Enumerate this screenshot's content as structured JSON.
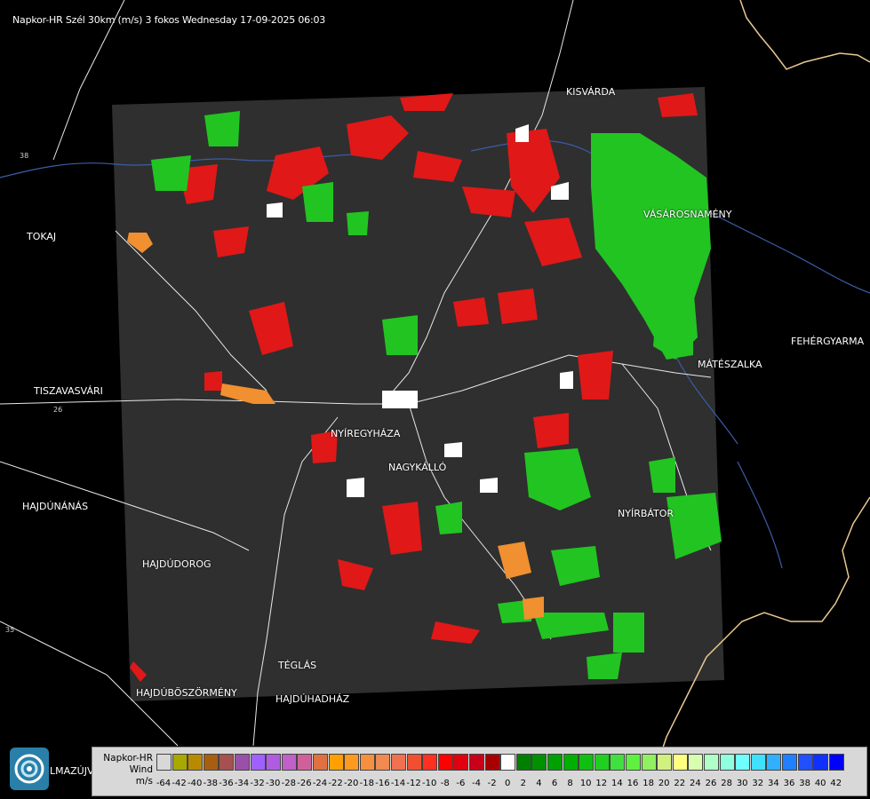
{
  "title": "Napkor-HR Szél 30km (m/s) 3 fokos Wednesday 17-09-2025 06:03",
  "towns": [
    {
      "id": "kisvarda",
      "name": "KISVÁRDA"
    },
    {
      "id": "tokaj",
      "name": "TOKAJ"
    },
    {
      "id": "vasarosnameny",
      "name": "VÁSÁROSNAMÉNY"
    },
    {
      "id": "fehergyarmat",
      "name": "FEHÉRGYARMA"
    },
    {
      "id": "mateszalka",
      "name": "MÁTÉSZALKA"
    },
    {
      "id": "tiszavasvari",
      "name": "TISZAVASVÁRI"
    },
    {
      "id": "nyiregyhaza",
      "name": "NYÍREGYHÁZA"
    },
    {
      "id": "nagykallo",
      "name": "NAGYKÁLLÓ"
    },
    {
      "id": "hajdunanas",
      "name": "HAJDÚNÁNÁS"
    },
    {
      "id": "nyirbator",
      "name": "NYÍRBÁTOR"
    },
    {
      "id": "hajdudorog",
      "name": "HAJDÚDOROG"
    },
    {
      "id": "teglas",
      "name": "TÉGLÁS"
    },
    {
      "id": "hajduboszormeny",
      "name": "HAJDÚBÖSZÖRMÉNY"
    },
    {
      "id": "hajduhadhaz",
      "name": "HAJDÚHADHÁZ"
    },
    {
      "id": "balmazujvaros",
      "name": "LMAZÚJVÁR"
    }
  ],
  "road_numbers": [
    "38",
    "26",
    "35"
  ],
  "legend": {
    "name_line1": "Napkor-HR",
    "name_line2": "Wind",
    "unit": "m/s",
    "ticks": [
      "-64",
      "-42",
      "-40",
      "-38",
      "-36",
      "-34",
      "-32",
      "-30",
      "-28",
      "-26",
      "-24",
      "-22",
      "-20",
      "-18",
      "-16",
      "-14",
      "-12",
      "-10",
      "-8",
      "-6",
      "-4",
      "-2",
      "0",
      "2",
      "4",
      "6",
      "8",
      "10",
      "12",
      "14",
      "16",
      "18",
      "20",
      "22",
      "24",
      "26",
      "28",
      "30",
      "32",
      "34",
      "36",
      "38",
      "40",
      "42"
    ],
    "colors": [
      "#d8d8d8",
      "#a8a800",
      "#b88a00",
      "#a85e10",
      "#a85050",
      "#9a50a8",
      "#a060ff",
      "#b05ce0",
      "#c060c8",
      "#d0609a",
      "#e07040",
      "#ffa000",
      "#ff9a20",
      "#f59040",
      "#f08a50",
      "#f07050",
      "#f05030",
      "#ff3020",
      "#ff0000",
      "#e00010",
      "#c80018",
      "#a80000",
      "#ffffff",
      "#008000",
      "#009000",
      "#00a000",
      "#00b000",
      "#10c010",
      "#20d020",
      "#40e040",
      "#60f040",
      "#90f060",
      "#d0f080",
      "#ffff80",
      "#d8ffb0",
      "#b0ffc8",
      "#90ffe0",
      "#70ffff",
      "#40e0ff",
      "#30b0ff",
      "#2080ff",
      "#2050ff",
      "#1030ff",
      "#0000ff"
    ]
  }
}
